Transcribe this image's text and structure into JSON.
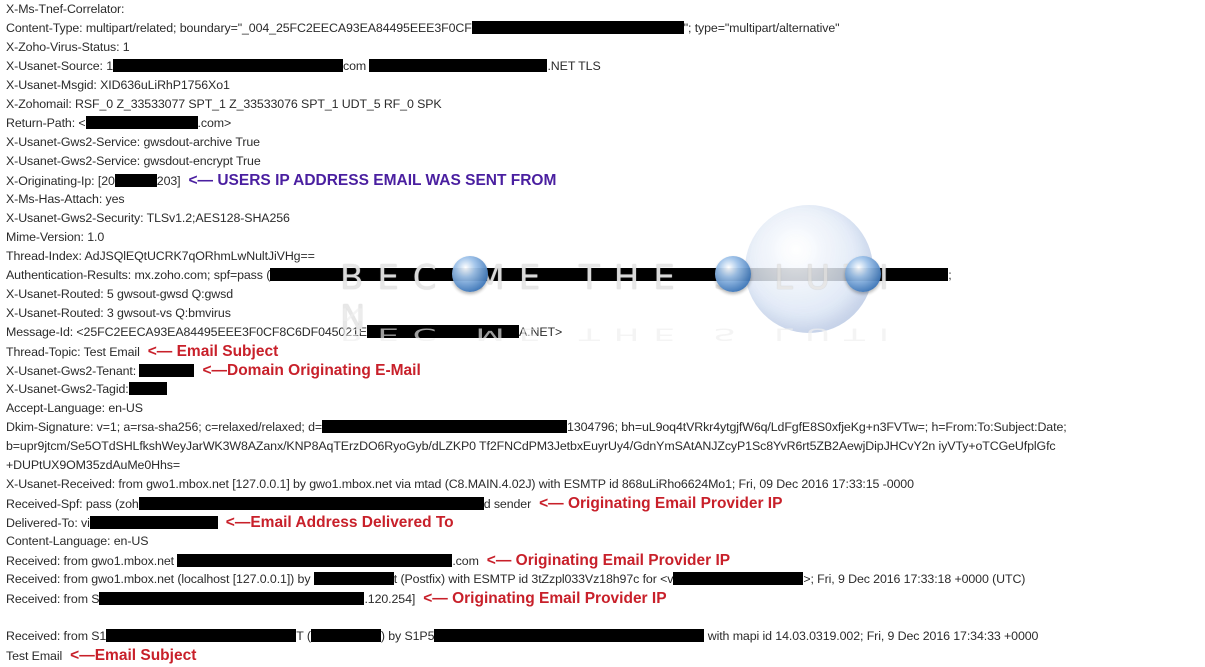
{
  "headers": [
    {
      "segments": [
        {
          "t": "X-Ms-Tnef-Correlator:"
        }
      ]
    },
    {
      "segments": [
        {
          "t": "Content-Type: multipart/related; boundary=\"_004_25FC2EECA93EA84495EEE3F0CF"
        },
        {
          "r": 212
        },
        {
          "t": "\"; type=\"multipart/alternative\""
        }
      ]
    },
    {
      "segments": [
        {
          "t": "X-Zoho-Virus-Status: 1"
        }
      ]
    },
    {
      "segments": [
        {
          "t": "X-Usanet-Source: 1"
        },
        {
          "r": 230
        },
        {
          "t": "com "
        },
        {
          "r": 178
        },
        {
          "t": ".NET TLS"
        }
      ]
    },
    {
      "segments": [
        {
          "t": "X-Usanet-Msgid: XID636uLiRhP1756Xo1"
        }
      ]
    },
    {
      "segments": [
        {
          "t": "X-Zohomail: RSF_0  Z_33533077 SPT_1 Z_33533076 SPT_1 UDT_5 RF_0 SPK"
        }
      ]
    },
    {
      "segments": [
        {
          "t": "Return-Path: <"
        },
        {
          "r": 112
        },
        {
          "t": ".com>"
        }
      ]
    },
    {
      "segments": [
        {
          "t": "X-Usanet-Gws2-Service: gwsdout-archive True"
        }
      ]
    },
    {
      "segments": [
        {
          "t": "X-Usanet-Gws2-Service: gwsdout-encrypt True"
        }
      ]
    },
    {
      "segments": [
        {
          "t": "X-Originating-Ip: [20"
        },
        {
          "r": 42
        },
        {
          "t": "203]"
        }
      ],
      "note": {
        "text": "<— USERS IP ADDRESS EMAIL WAS SENT FROM",
        "color": "purple"
      }
    },
    {
      "segments": [
        {
          "t": "X-Ms-Has-Attach: yes"
        }
      ]
    },
    {
      "segments": [
        {
          "t": "X-Usanet-Gws2-Security: TLSv1.2;AES128-SHA256"
        }
      ]
    },
    {
      "segments": [
        {
          "t": "Mime-Version: 1.0"
        }
      ]
    },
    {
      "segments": [
        {
          "t": "Thread-Index: AdJSQlEQtUCRK7qORhmLwNultJiVHg=="
        }
      ]
    },
    {
      "segments": [
        {
          "t": "Authentication-Results: mx.zoho.com; spf=pass ("
        },
        {
          "r": 678
        },
        {
          "t": ";"
        }
      ]
    },
    {
      "segments": [
        {
          "t": "X-Usanet-Routed: 5 gwsout-gwsd Q:gwsd"
        }
      ]
    },
    {
      "segments": [
        {
          "t": "X-Usanet-Routed: 3 gwsout-vs Q:bmvirus"
        }
      ]
    },
    {
      "segments": [
        {
          "t": "Message-Id: <25FC2EECA93EA84495EEE3F0CF8C6DF045021E"
        },
        {
          "r": 152
        },
        {
          "t": "A.NET>"
        }
      ]
    },
    {
      "segments": [
        {
          "t": "Thread-Topic: Test Email"
        }
      ],
      "note": {
        "text": "<— Email Subject",
        "color": "red"
      }
    },
    {
      "segments": [
        {
          "t": "X-Usanet-Gws2-Tenant: "
        },
        {
          "r": 55
        }
      ],
      "note": {
        "text": "<—Domain Originating E-Mail",
        "color": "red"
      }
    },
    {
      "segments": [
        {
          "t": "X-Usanet-Gws2-Tagid:"
        },
        {
          "r": 38
        }
      ]
    },
    {
      "segments": [
        {
          "t": "Accept-Language: en-US"
        }
      ]
    },
    {
      "segments": [
        {
          "t": "Dkim-Signature: v=1; a=rsa-sha256; c=relaxed/relaxed; d="
        },
        {
          "r": 245
        },
        {
          "t": "1304796; bh=uL9oq4tVRkr4ytgjfW6q/LdFgfE8S0xfjeKg+n3FVTw=; h=From:To:Subject:Date;"
        }
      ]
    },
    {
      "segments": [
        {
          "t": "b=upr9jtcm/Se5OTdSHLfkshWeyJarWK3W8AZanx/KNP8AqTErzDO6RyoGyb/dLZKP0 Tf2FNCdPM3JetbxEuyrUy4/GdnYmSAtANJZcyP1Sc8YvR6rt5ZB2AewjDipJHCvY2n iyVTy+oTCGeUfplGfc"
        }
      ]
    },
    {
      "segments": [
        {
          "t": "+DUPtUX9OM35zdAuMe0Hhs="
        }
      ]
    },
    {
      "segments": [
        {
          "t": "X-Usanet-Received: from gwo1.mbox.net [127.0.0.1] by gwo1.mbox.net via mtad (C8.MAIN.4.02J)  with ESMTP id 868uLiRho6624Mo1; Fri, 09 Dec 2016 17:33:15 -0000"
        }
      ]
    },
    {
      "segments": [
        {
          "t": "Received-Spf: pass (zoh"
        },
        {
          "r": 345
        },
        {
          "t": "d sender"
        }
      ],
      "note": {
        "text": "<— Originating Email Provider IP",
        "color": "red"
      }
    },
    {
      "segments": [
        {
          "t": "Delivered-To: vi"
        },
        {
          "r": 128
        }
      ],
      "note": {
        "text": "<—Email Address Delivered To",
        "color": "red"
      }
    },
    {
      "segments": [
        {
          "t": "Content-Language: en-US"
        }
      ]
    },
    {
      "segments": [
        {
          "t": "Received: from gwo1.mbox.net "
        },
        {
          "r": 275
        },
        {
          "t": ".com"
        }
      ],
      "note": {
        "text": "<— Originating Email Provider IP",
        "color": "red"
      }
    },
    {
      "segments": [
        {
          "t": "Received: from gwo1.mbox.net (localhost [127.0.0.1]) by "
        },
        {
          "r": 80
        },
        {
          "t": "t (Postfix) with ESMTP id 3tZzpl033Vz18h97c for <v"
        },
        {
          "r": 130
        },
        {
          "t": ">; Fri,  9 Dec 2016 17:33:18 +0000 (UTC)"
        }
      ]
    },
    {
      "segments": [
        {
          "t": "Received: from S"
        },
        {
          "r": 265
        },
        {
          "t": ".120.254]"
        }
      ],
      "note": {
        "text": "<— Originating Email Provider IP",
        "color": "red"
      }
    },
    {
      "blank": true
    },
    {
      "segments": [
        {
          "t": "Received: from S1"
        },
        {
          "r": 190
        },
        {
          "t": "T ("
        },
        {
          "r": 70
        },
        {
          "t": ") by S1P5"
        },
        {
          "r": 270
        },
        {
          "t": " with mapi id 14.03.0319.002; Fri, 9 Dec 2016 17:34:33 +0000"
        }
      ]
    },
    {
      "segments": [
        {
          "t": "Test Email"
        }
      ],
      "note": {
        "text": "<—Email Subject",
        "color": "red"
      }
    }
  ],
  "watermark": {
    "text": "BEC  ME THE S  LUTI  N"
  },
  "colors": {
    "annotation_red": "#c8202a",
    "annotation_purple": "#4a1fa0",
    "text": "#2b2b2b",
    "redaction": "#000000"
  }
}
